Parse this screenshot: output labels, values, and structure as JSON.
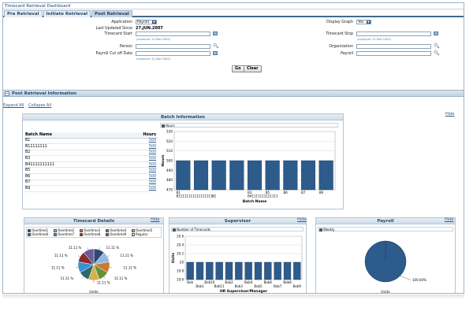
{
  "window": {
    "title": "Timecard Retrieval Dashboard"
  },
  "tabs": [
    {
      "label": "Pre Retrieval",
      "active": false
    },
    {
      "label": "Initiate Retrieval",
      "active": false
    },
    {
      "label": "Post Retrieval",
      "active": true
    }
  ],
  "form": {
    "application_label": "Application",
    "application_value": "Payroll",
    "last_updated_label": "Last Updated Since",
    "last_updated_value": "27.JUN.2007",
    "timecard_start_label": "Timecard Start",
    "timecard_start_hint": "(example: 22.Mar.2005)",
    "person_label": "Person",
    "payroll_cutoff_label": "Payroll Cut off Date",
    "payroll_cutoff_hint": "(example: 22.Mar.2005)",
    "display_graph_label": "Display Graph",
    "display_graph_value": "Yes",
    "timecard_stop_label": "Timecard Stop",
    "timecard_stop_hint": "(example: 22.Mar.2005)",
    "organization_label": "Organization",
    "payroll_label": "Payroll",
    "go_label": "Go",
    "clear_label": "Clear"
  },
  "section": {
    "title": "Post Retrieval Information",
    "toggle": "−"
  },
  "links": {
    "expand_all": "Expand All",
    "collapse_all": "Collapse All"
  },
  "batch_panel": {
    "title": "Batch Information",
    "hide": "Hide",
    "col_name": "Batch Name",
    "col_hours": "Hours",
    "rows": [
      {
        "name": "B1",
        "hours": "500"
      },
      {
        "name": "B11111111",
        "hours": "500"
      },
      {
        "name": "B2",
        "hours": "500"
      },
      {
        "name": "B3",
        "hours": "500"
      },
      {
        "name": "B41111111111",
        "hours": "500"
      },
      {
        "name": "B5",
        "hours": "500"
      },
      {
        "name": "B6",
        "hours": "500"
      },
      {
        "name": "B7",
        "hours": "500"
      },
      {
        "name": "B9",
        "hours": "500"
      }
    ]
  },
  "timecard_panel": {
    "title": "Timecard Details",
    "hide": "Hide",
    "legend": [
      "Overtime1",
      "Overtime2",
      "Overtime3",
      "Overtime4",
      "Overtime5",
      "Overtime6",
      "Overtime7",
      "Overtime8",
      "Overtime9",
      "Regular"
    ],
    "legend_colors": [
      "#2d4a6e",
      "#8fb9e4",
      "#c97a2a",
      "#6a8f3a",
      "#d4b24a",
      "#2a6a6a",
      "#3a8fd6",
      "#8a2a2a",
      "#6a5aa0",
      "#e8e0b0"
    ]
  },
  "supervisor_panel": {
    "title": "Supervisor",
    "hide": "Hide"
  },
  "payroll_panel": {
    "title": "Payroll",
    "hide": "Hide"
  },
  "chart_data": [
    {
      "type": "bar",
      "legend": [
        "Hours"
      ],
      "categories": [
        "B1",
        "B11111111111111111",
        "B2",
        "B3",
        "B41111111111111",
        "B5",
        "B6",
        "B7",
        "B9"
      ],
      "series": [
        {
          "name": "Hours",
          "values": [
            500,
            500,
            500,
            500,
            500,
            500,
            500,
            500,
            500
          ]
        }
      ],
      "xlabel": "Batch Name",
      "ylabel": "Hours",
      "ylim": [
        470,
        530
      ],
      "yticks": [
        470,
        480,
        490,
        500,
        510,
        520,
        530
      ],
      "color": "#2d5b8c"
    },
    {
      "type": "pie",
      "labels": [
        "Overtime1",
        "Overtime2",
        "Overtime3",
        "Overtime4",
        "Overtime5",
        "Overtime6",
        "Overtime7",
        "Overtime8",
        "Overtime9",
        "Regular"
      ],
      "values": [
        11.11,
        11.11,
        11.11,
        11.11,
        11.11,
        11.11,
        11.11,
        11.11,
        11.11,
        0
      ],
      "slice_label": "11.11 %",
      "xlabel": "Units"
    },
    {
      "type": "bar",
      "legend": [
        "Number of Timecards"
      ],
      "categories": [
        "Bob",
        "Bob1",
        "Bob10",
        "Bob11",
        "Bob2",
        "Bob3",
        "Bob4",
        "Bob5",
        "Bob6",
        "Bob7",
        "Bob8",
        "Bob9"
      ],
      "series": [
        {
          "name": "Number of Timecards",
          "values": [
            20,
            20,
            20,
            20,
            20,
            20,
            20,
            20,
            20,
            20,
            20,
            20
          ]
        }
      ],
      "xlabel": "HR Supervisor/Manager",
      "ylabel": "Units",
      "ylim": [
        19.6,
        20.6
      ],
      "yticks": [
        "19.6",
        "19.8",
        "20",
        "20.2",
        "20.4",
        "20.6"
      ],
      "color": "#2d5b8c"
    },
    {
      "type": "pie",
      "legend": [
        "Weekly"
      ],
      "labels": [
        "Weekly"
      ],
      "values": [
        100
      ],
      "slice_label": "100.00%",
      "xlabel": "Units",
      "color": "#2d5b8c"
    }
  ]
}
